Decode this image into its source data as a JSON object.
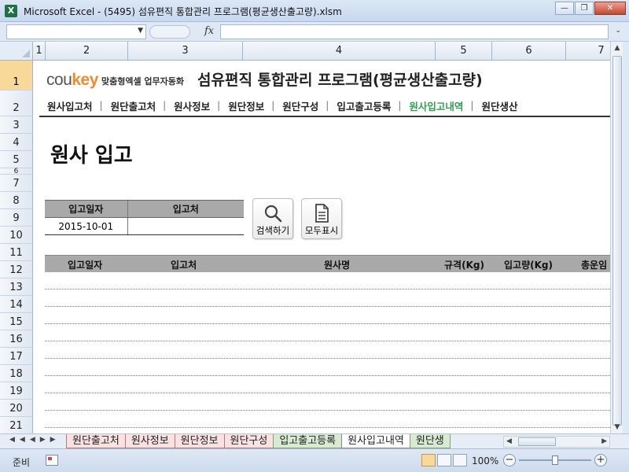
{
  "window": {
    "title": "Microsoft Excel - (5495) 섬유편직 통합관리 프로그램(평균생산출고량).xlsm",
    "app_icon": "X"
  },
  "formula_bar": {
    "fx_label": "fx",
    "name_box": "",
    "formula": ""
  },
  "columns": [
    "1",
    "2",
    "3",
    "4",
    "5",
    "6",
    "7"
  ],
  "rows": [
    "1",
    "2",
    "3",
    "4",
    "5",
    "6",
    "7",
    "8",
    "9",
    "10",
    "11",
    "12",
    "13",
    "14",
    "15",
    "16",
    "17",
    "18",
    "19",
    "20",
    "21"
  ],
  "header": {
    "logo_main": "cou",
    "logo_accent": "key",
    "logo_sub": "맞춤형엑셀 업무자동화",
    "app_title": "섬유편직 통합관리 프로그램(평균생산출고량)"
  },
  "nav": {
    "items": [
      "원사입고처",
      "원단출고처",
      "원사정보",
      "원단정보",
      "원단구성",
      "입고출고등록",
      "원사입고내역",
      "원단생산"
    ],
    "active_index": 6,
    "active_color": "#2e9e53"
  },
  "page": {
    "heading": "원사 입고"
  },
  "filter": {
    "headers": [
      "입고일자",
      "입고처"
    ],
    "values": [
      "2015-10-01",
      ""
    ]
  },
  "buttons": {
    "search": "검색하기",
    "show_all": "모두표시"
  },
  "list": {
    "headers": [
      "입고일자",
      "입고처",
      "원사명",
      "규격(Kg)",
      "입고량(Kg)",
      "총운임"
    ]
  },
  "sheet_tabs": [
    {
      "label": "원단출고처",
      "color": "pink"
    },
    {
      "label": "원사정보",
      "color": "pink"
    },
    {
      "label": "원단정보",
      "color": "pink"
    },
    {
      "label": "원단구성",
      "color": "pink"
    },
    {
      "label": "입고출고등록",
      "color": "green"
    },
    {
      "label": "원사입고내역",
      "color": "active"
    },
    {
      "label": "원단생",
      "color": "green"
    }
  ],
  "status": {
    "ready": "준비",
    "zoom": "100%"
  }
}
